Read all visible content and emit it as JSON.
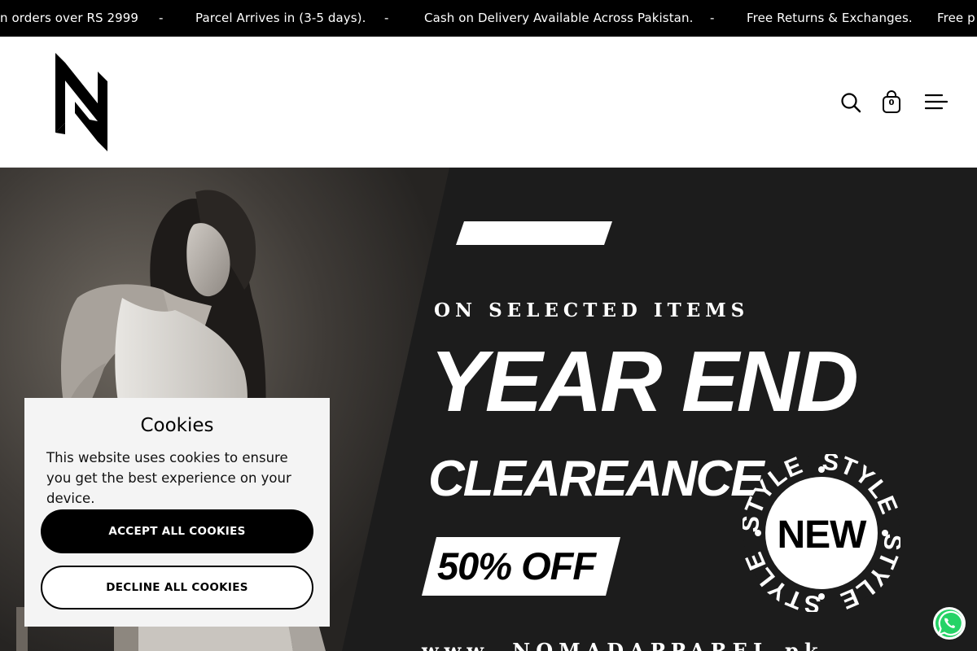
{
  "announcement": {
    "items": [
      "n orders over RS 2999",
      "Parcel Arrives in (3-5 days).",
      "Cash on Delivery Available Across Pakistan.",
      "Free Returns & Exchanges.",
      "Free p"
    ],
    "separator": "-"
  },
  "header": {
    "cart_count": "0",
    "logo_icon": "nomad-n-logo",
    "icons": [
      "search-icon",
      "cart-icon",
      "menu-icon"
    ]
  },
  "hero": {
    "subline": "ON SELECTED ITEMS",
    "headline_1": "YEAR END",
    "headline_2": "CLEAREANCE",
    "offer": "50% OFF",
    "badge_center": "NEW",
    "badge_ring": "STYLE",
    "url": "www. NOMADAPPAREL.pk"
  },
  "cookie": {
    "title": "Cookies",
    "text": "This website uses cookies to ensure you get the best experience on your device.",
    "accept_label": "ACCEPT ALL COOKIES",
    "decline_label": "DECLINE ALL COOKIES"
  },
  "colors": {
    "bar": "#000000",
    "popup": "#f4f4f4",
    "whatsapp": "#25d366"
  }
}
